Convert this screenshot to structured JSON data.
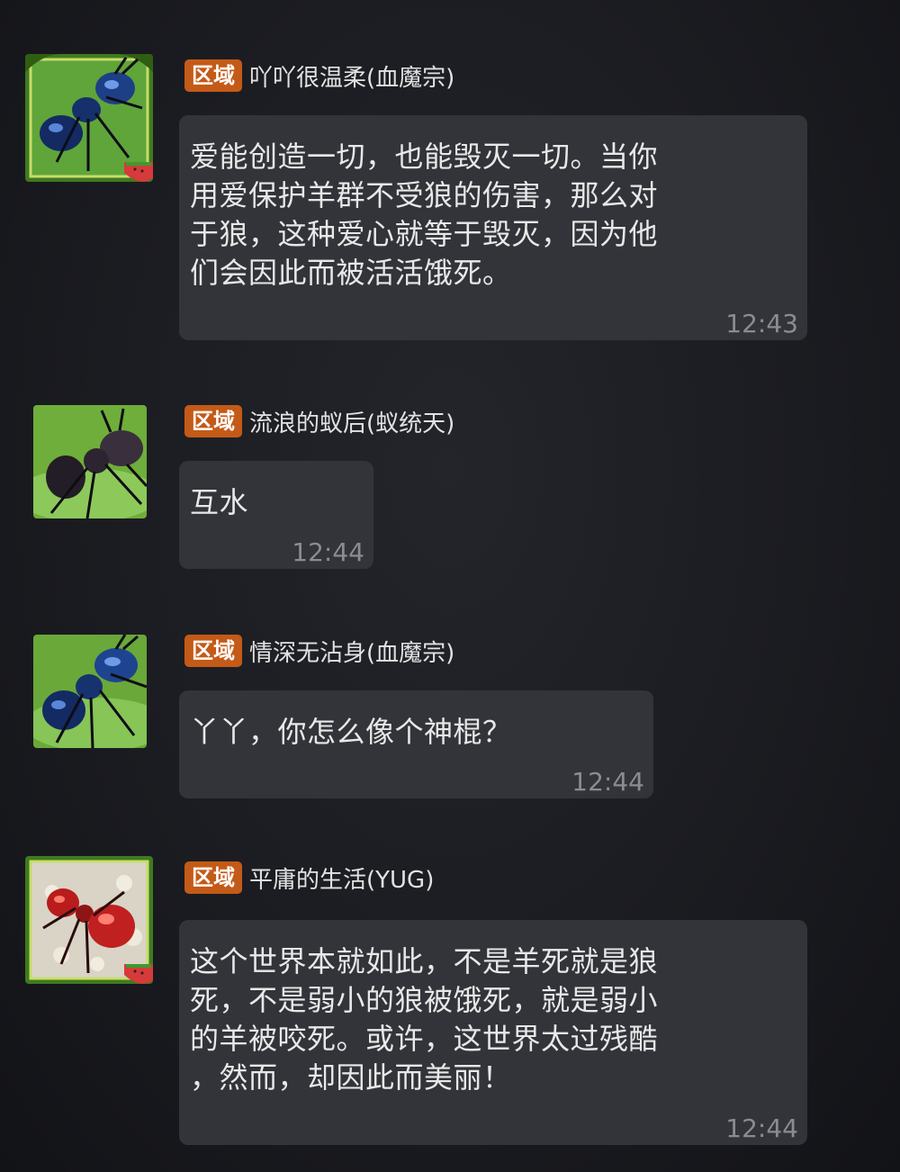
{
  "messages": [
    {
      "badge": "区域",
      "sender": "吖吖很温柔(血魔宗)",
      "text": "爱能创造一切，也能毁灭一切。当你\n用爱保护羊群不受狼的伤害，那么对\n于狼，这种爱心就等于毁灭，因为他\n们会因此而被活活饿死。",
      "time": "12:43",
      "avatar_icon": "blue-ant-avatar-icon"
    },
    {
      "badge": "区域",
      "sender": "流浪的蚁后(蚁统天)",
      "text": "互水",
      "time": "12:44",
      "avatar_icon": "dark-ant-avatar-icon"
    },
    {
      "badge": "区域",
      "sender": "情深无沾身(血魔宗)",
      "text": "丫丫，你怎么像个神棍？",
      "time": "12:44",
      "avatar_icon": "blue-ant-avatar-icon"
    },
    {
      "badge": "区域",
      "sender": "平庸的生活(YUG)",
      "text": "这个世界本就如此，不是羊死就是狼\n死，不是弱小的狼被饿死，就是弱小\n的羊被咬死。或许，这世界太过残酷\n，然而，却因此而美丽！",
      "time": "12:44",
      "avatar_icon": "red-ant-avatar-icon"
    }
  ],
  "colors": {
    "background": "#1b1c21",
    "bubble": "#323439",
    "badge": "#c45a17",
    "time": "#8a8c90"
  }
}
